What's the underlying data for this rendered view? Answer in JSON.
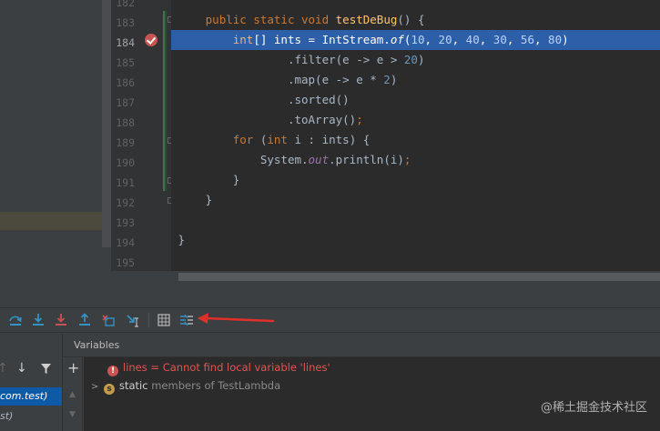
{
  "editor": {
    "line_numbers": [
      "182",
      "183",
      "184",
      "185",
      "186",
      "187",
      "188",
      "189",
      "190",
      "191",
      "192",
      "193",
      "194",
      "195"
    ],
    "current_line": "184",
    "lines": [
      {
        "n": "183",
        "parts": [
          [
            "kw",
            "public static void "
          ],
          [
            "fn",
            "testDeBug"
          ],
          [
            "",
            "() {"
          ]
        ],
        "indent": "    "
      },
      {
        "n": "184",
        "parts": [
          [
            "kw",
            "int"
          ],
          [
            "",
            "[] ints = IntStream."
          ],
          [
            "it",
            "of"
          ],
          [
            "",
            "("
          ],
          [
            "num",
            "10"
          ],
          [
            "",
            ", "
          ],
          [
            "num",
            "20"
          ],
          [
            "",
            ", "
          ],
          [
            "num",
            "40"
          ],
          [
            "",
            ", "
          ],
          [
            "num",
            "30"
          ],
          [
            "",
            ", "
          ],
          [
            "num",
            "56"
          ],
          [
            "",
            ", "
          ],
          [
            "num",
            "80"
          ],
          [
            "",
            ")"
          ]
        ],
        "indent": "        ",
        "exec": true
      },
      {
        "n": "185",
        "parts": [
          [
            "",
            ".filter(e -> e > "
          ],
          [
            "num",
            "20"
          ],
          [
            "",
            ")"
          ]
        ],
        "indent": "                "
      },
      {
        "n": "186",
        "parts": [
          [
            "",
            ".map(e -> e * "
          ],
          [
            "num",
            "2"
          ],
          [
            "",
            ")"
          ]
        ],
        "indent": "                "
      },
      {
        "n": "187",
        "parts": [
          [
            "",
            ".sorted()"
          ]
        ],
        "indent": "                "
      },
      {
        "n": "188",
        "parts": [
          [
            "",
            ".toArray()"
          ],
          [
            "kw",
            ";"
          ]
        ],
        "indent": "                "
      },
      {
        "n": "189",
        "parts": [
          [
            "kw",
            "for "
          ],
          [
            "",
            "("
          ],
          [
            "kw",
            "int "
          ],
          [
            "",
            "i : ints) {"
          ]
        ],
        "indent": "        "
      },
      {
        "n": "190",
        "parts": [
          [
            "",
            "System."
          ],
          [
            "it",
            "out"
          ],
          [
            "",
            ".println(i)"
          ],
          [
            "kw",
            ";"
          ]
        ],
        "indent": "            "
      },
      {
        "n": "191",
        "parts": [
          [
            "",
            "}"
          ]
        ],
        "indent": "        "
      },
      {
        "n": "192",
        "parts": [
          [
            "",
            "}"
          ]
        ],
        "indent": "    "
      },
      {
        "n": "193",
        "parts": [],
        "indent": ""
      },
      {
        "n": "194",
        "parts": [
          [
            "",
            "}"
          ]
        ],
        "indent": ""
      },
      {
        "n": "195",
        "parts": [],
        "indent": ""
      }
    ]
  },
  "debug": {
    "toolbar_icons": [
      "step-over-icon",
      "step-into-icon",
      "force-step-into-icon",
      "step-out-icon",
      "drop-frame-icon",
      "run-to-cursor-icon",
      "evaluate-expression-icon",
      "trace-stream-icon"
    ],
    "variables_title": "Variables",
    "frames": [
      {
        "label": "com.test)",
        "selected": true
      },
      {
        "label": "st)",
        "selected": false
      }
    ],
    "variables": {
      "error_name": "lines",
      "error_sep": " = ",
      "error_message": "Cannot find local variable 'lines'",
      "static_icon_letter": "s",
      "static_label": "static",
      "static_members": " members of TestLambda"
    },
    "watermark": "@稀土掘金技术社区"
  },
  "colors": {
    "accent_exec_line": "#2d5ea8",
    "breakpoint": "#c75450",
    "annotation_arrow": "#e0302a"
  }
}
